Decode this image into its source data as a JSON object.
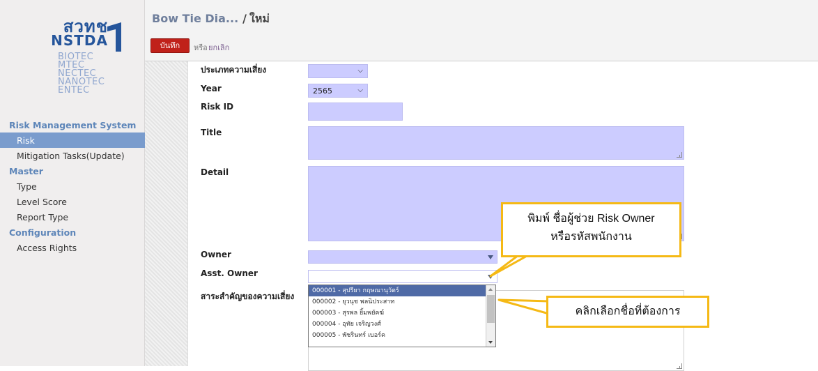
{
  "sidebar": {
    "logo": {
      "word": "สวทช",
      "brand": "NSTDA",
      "subs": [
        "BIOTEC",
        "MTEC",
        "NECTEC",
        "NANOTEC",
        "ENTEC"
      ]
    },
    "sections": [
      {
        "title": "Risk Management System",
        "items": [
          "Risk",
          "Mitigation Tasks(Update)"
        ]
      },
      {
        "title": "Master",
        "items": [
          "Type",
          "Level Score",
          "Report Type"
        ]
      },
      {
        "title": "Configuration",
        "items": [
          "Access Rights"
        ]
      }
    ],
    "active_item": "Risk"
  },
  "header": {
    "breadcrumb_parent": "Bow Tie Dia...",
    "breadcrumb_sep": "/",
    "breadcrumb_current": "ใหม่",
    "save_label": "บันทึก",
    "or_label": "หรือ",
    "discard_label": "ยกเลิก"
  },
  "form": {
    "risk_category_label": "ประเภทความเสี่ยง",
    "risk_category_value": "",
    "year_label": "Year",
    "year_value": "2565",
    "risk_id_label": "Risk ID",
    "title_label": "Title",
    "detail_label": "Detail",
    "owner_label": "Owner",
    "asst_owner_label": "Asst. Owner",
    "essence_label": "สาระสำคัญของความเสี่ยง"
  },
  "dropdown": {
    "items": [
      "000001 - สุปรียา กฤษณานุวัตร์",
      "000002 - ยุวนุช พลนิประสาท",
      "000003 - สุรพล ยิ้มพยัคฆ์",
      "000004 - อุทัย เจริญวงศ์",
      "000005 - พัชรินทร์ เบอร์ค"
    ],
    "selected_index": 0
  },
  "callouts": {
    "type_hint_line1": "พิมพ์ ชื่อผู้ช่วย Risk Owner",
    "type_hint_line2": "หรือรหัสพนักงาน",
    "click_hint": "คลิกเลือกชื่อที่ต้องการ"
  },
  "colors": {
    "sidebar_bg": "#f0eeee",
    "active_item_bg": "#7a9ccd",
    "section_title": "#5e86b9",
    "field_bg": "#ccccff",
    "save_button": "#c0211a",
    "callout_border": "#f5b915",
    "dropdown_selected": "#4f6aa6"
  }
}
